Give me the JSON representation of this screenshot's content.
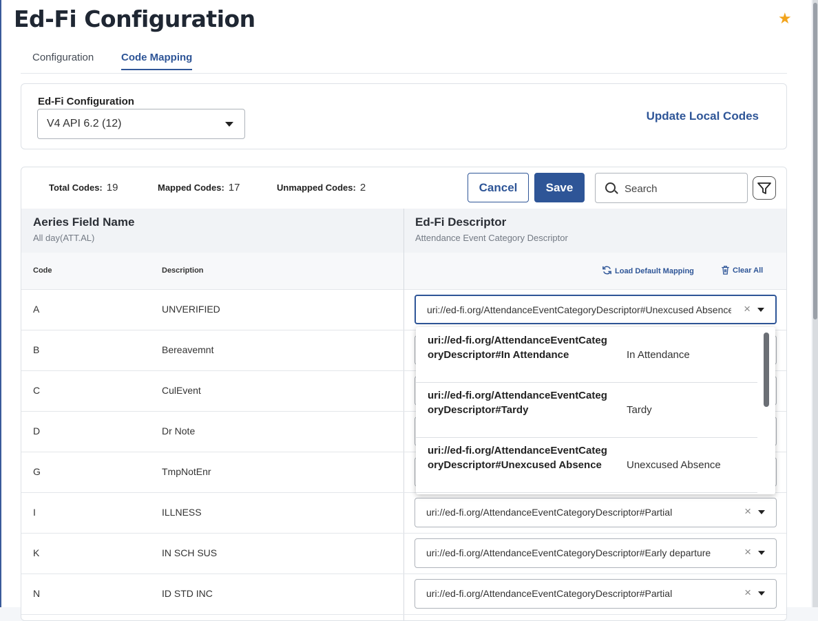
{
  "page": {
    "title": "Ed-Fi Configuration"
  },
  "tabs": [
    {
      "label": "Configuration",
      "active": false
    },
    {
      "label": "Code Mapping",
      "active": true
    }
  ],
  "config": {
    "label": "Ed-Fi Configuration",
    "selected": "V4 API 6.2 (12)",
    "update_link": "Update Local Codes"
  },
  "stats": {
    "total_label": "Total Codes:",
    "total": "19",
    "mapped_label": "Mapped Codes:",
    "mapped": "17",
    "unmapped_label": "Unmapped Codes:",
    "unmapped": "2"
  },
  "toolbar": {
    "cancel": "Cancel",
    "save": "Save",
    "search_placeholder": "Search"
  },
  "columns": {
    "left_title": "Aeries Field Name",
    "left_sub": "All day(ATT.AL)",
    "right_title": "Ed-Fi Descriptor",
    "right_sub": "Attendance Event Category Descriptor",
    "code": "Code",
    "description": "Description",
    "load_default": "Load Default Mapping",
    "clear_all": "Clear All"
  },
  "rows": [
    {
      "code": "A",
      "description": "UNVERIFIED",
      "mapping": "uri://ed-fi.org/AttendanceEventCategoryDescriptor#Unexcused Absence"
    },
    {
      "code": "B",
      "description": "Bereavemnt",
      "mapping": ""
    },
    {
      "code": "C",
      "description": "CulEvent",
      "mapping": ""
    },
    {
      "code": "D",
      "description": "Dr Note",
      "mapping": ""
    },
    {
      "code": "G",
      "description": "TmpNotEnr",
      "mapping": ""
    },
    {
      "code": "I",
      "description": "ILLNESS",
      "mapping": "uri://ed-fi.org/AttendanceEventCategoryDescriptor#Partial"
    },
    {
      "code": "K",
      "description": "IN SCH SUS",
      "mapping": "uri://ed-fi.org/AttendanceEventCategoryDescriptor#Early departure"
    },
    {
      "code": "N",
      "description": "ID STD INC",
      "mapping": "uri://ed-fi.org/AttendanceEventCategoryDescriptor#Partial"
    }
  ],
  "dropdown": [
    {
      "uri": "uri://ed-fi.org/AttendanceEventCategoryDescriptor#In Attendance",
      "label": "In Attendance"
    },
    {
      "uri": "uri://ed-fi.org/AttendanceEventCategoryDescriptor#Tardy",
      "label": "Tardy"
    },
    {
      "uri": "uri://ed-fi.org/AttendanceEventCategoryDescriptor#Unexcused Absence",
      "label": "Unexcused Absence"
    }
  ],
  "colors": {
    "accent": "#2e5597",
    "star": "#f2a41c"
  },
  "icons": {
    "favorite": "star-icon",
    "search": "search-icon",
    "filter": "filter-icon",
    "reload": "refresh-icon",
    "clear": "trash-icon"
  }
}
